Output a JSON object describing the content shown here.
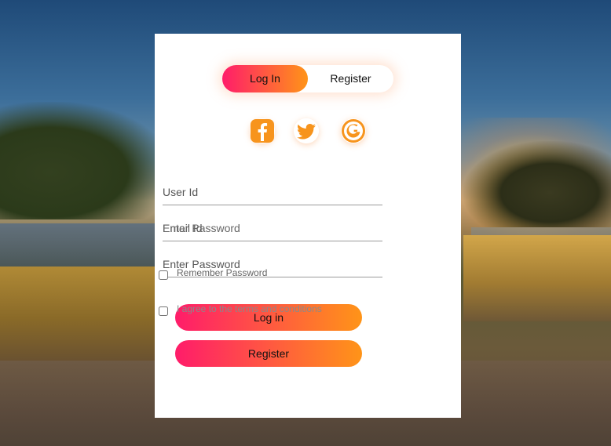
{
  "toggle": {
    "login_label": "Log In",
    "register_label": "Register"
  },
  "social": {
    "icons": [
      "facebook-icon",
      "twitter-icon",
      "google-icon"
    ]
  },
  "form": {
    "user_id_placeholder": "User Id",
    "email_placeholder": "Email Id",
    "password_placeholder": "Enter Password",
    "overlap_text": "Enter Password",
    "remember_label": "Remember Password",
    "terms_label": "I agree to the terms and conditions"
  },
  "buttons": {
    "login_label": "Log in",
    "register_label": "Register"
  },
  "colors": {
    "gradient_start": "#ff1c6a",
    "gradient_end": "#ff9418",
    "icon_orange": "#f7941d"
  }
}
